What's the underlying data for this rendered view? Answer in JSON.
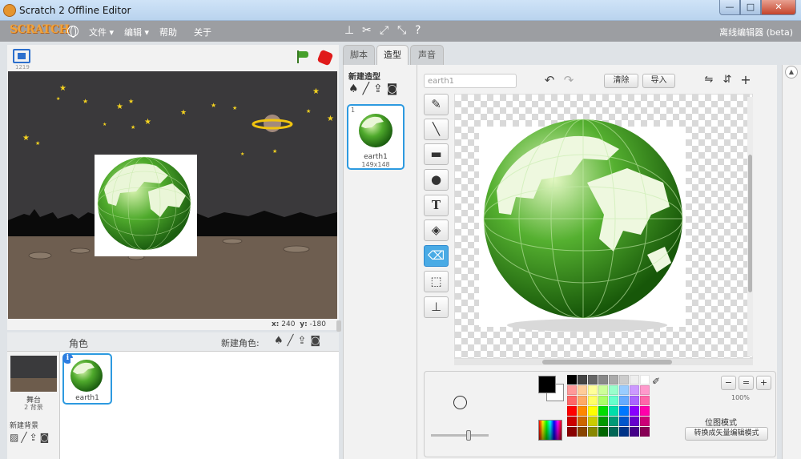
{
  "window": {
    "title": "Scratch 2 Offline Editor",
    "min": "—",
    "max": "□",
    "close": "✕"
  },
  "menu": {
    "logo": "SCRATCH",
    "file": "文件 ▾",
    "edit": "编辑 ▾",
    "help": "帮助",
    "about": "关于",
    "right_label": "离线编辑器 (beta)"
  },
  "stage": {
    "version": "1219",
    "coord_x_label": "x:",
    "coord_x": "240",
    "coord_y_label": "y:",
    "coord_y": "-180"
  },
  "sprites": {
    "header": "角色",
    "new_sprite": "新建角色:",
    "backdrop_label": "舞台",
    "backdrop_count": "2 背景",
    "new_backdrop": "新建背景",
    "sprite_name": "earth1",
    "info": "i"
  },
  "tabs": [
    {
      "label": "脚本"
    },
    {
      "label": "造型"
    },
    {
      "label": "声音"
    }
  ],
  "costumes": {
    "new_costume": "新建造型",
    "number": "1",
    "name": "earth1",
    "size": "149x148"
  },
  "editor": {
    "name_value": "earth1",
    "clear": "清除",
    "import": "导入",
    "zoom_pct": "100%",
    "mode": "位图模式",
    "convert": "转换成矢量编辑模式"
  },
  "palette": [
    "#000000",
    "#444444",
    "#666666",
    "#888888",
    "#aaaaaa",
    "#cccccc",
    "#eeeeee",
    "#ffffff",
    "#ff9999",
    "#ffcc99",
    "#ffff99",
    "#ccff99",
    "#99ffcc",
    "#99ccff",
    "#cc99ff",
    "#ff99cc",
    "#ff6666",
    "#ffaa66",
    "#ffff66",
    "#aaff66",
    "#66ffcc",
    "#66aaff",
    "#aa66ff",
    "#ff66aa",
    "#ff0000",
    "#ff8800",
    "#ffff00",
    "#00dd00",
    "#00ddaa",
    "#0077ff",
    "#8800ff",
    "#ff00aa",
    "#cc0000",
    "#cc6600",
    "#cccc00",
    "#009900",
    "#009977",
    "#0055cc",
    "#6600cc",
    "#cc0077",
    "#880000",
    "#884400",
    "#888800",
    "#006600",
    "#006655",
    "#003388",
    "#440088",
    "#880055"
  ]
}
